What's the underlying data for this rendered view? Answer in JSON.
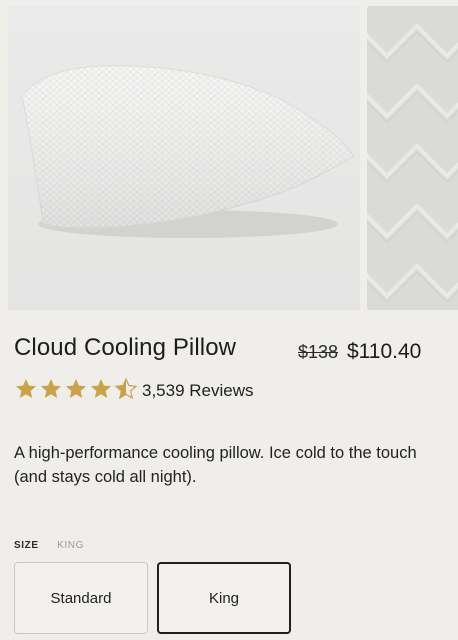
{
  "product": {
    "title": "Cloud Cooling Pillow",
    "original_price": "$138",
    "price": "$110.40",
    "rating_stars": 4.5,
    "reviews": "3,539 Reviews",
    "description": "A high-performance cooling pillow. Ice cold to the touch (and stays cold all night)."
  },
  "size": {
    "label": "SIZE",
    "selected": "KING",
    "options": [
      {
        "label": "Standard",
        "selected": false
      },
      {
        "label": "King",
        "selected": true
      }
    ]
  },
  "images": {
    "main": "pillow-photo",
    "thumbnail": "fabric-texture-photo"
  },
  "colors": {
    "star": "#c9a24a",
    "text": "#1f1f1f",
    "selected_border": "#1f1f1f",
    "background": "#efeeea"
  }
}
